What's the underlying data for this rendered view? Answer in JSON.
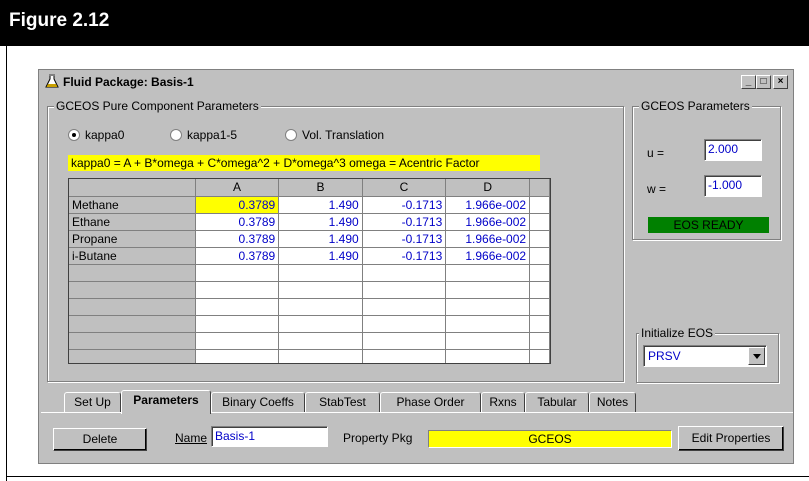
{
  "figure": {
    "title": "Figure 2.12"
  },
  "window": {
    "title": "Fluid Package: Basis-1",
    "controls": [
      "_",
      "□",
      "×"
    ]
  },
  "pure_params": {
    "group_title": "GCEOS Pure Component Parameters",
    "radios": [
      {
        "label": "kappa0",
        "selected": true
      },
      {
        "label": "kappa1-5",
        "selected": false
      },
      {
        "label": "Vol. Translation",
        "selected": false
      }
    ],
    "formula": "kappa0 = A + B*omega + C*omega^2 + D*omega^3    omega = Acentric Factor",
    "columns": [
      "A",
      "B",
      "C",
      "D"
    ],
    "rows": [
      {
        "name": "Methane",
        "A": "0.3789",
        "B": "1.490",
        "C": "-0.1713",
        "D": "1.966e-002"
      },
      {
        "name": "Ethane",
        "A": "0.3789",
        "B": "1.490",
        "C": "-0.1713",
        "D": "1.966e-002"
      },
      {
        "name": "Propane",
        "A": "0.3789",
        "B": "1.490",
        "C": "-0.1713",
        "D": "1.966e-002"
      },
      {
        "name": "i-Butane",
        "A": "0.3789",
        "B": "1.490",
        "C": "-0.1713",
        "D": "1.966e-002"
      }
    ]
  },
  "gceos_params": {
    "group_title": "GCEOS Parameters",
    "u_label": "u =",
    "u_value": "2.000",
    "w_label": "w =",
    "w_value": "-1.000",
    "status": "EOS READY"
  },
  "init_eos": {
    "group_title": "Initialize EOS",
    "selected": "PRSV"
  },
  "tabs": [
    "Set Up",
    "Parameters",
    "Binary Coeffs",
    "StabTest",
    "Phase Order",
    "Rxns",
    "Tabular",
    "Notes"
  ],
  "active_tab": "Parameters",
  "bottom": {
    "delete_label": "Delete",
    "name_label": "Name",
    "name_value": "Basis-1",
    "property_pkg_label": "Property Pkg",
    "property_pkg_value": "GCEOS",
    "edit_properties_label": "Edit Properties"
  },
  "colors": {
    "highlight": "#ffff00",
    "status_ok": "#008000",
    "value_text": "#0000c8",
    "dialog_bg": "#c0c0c0"
  }
}
